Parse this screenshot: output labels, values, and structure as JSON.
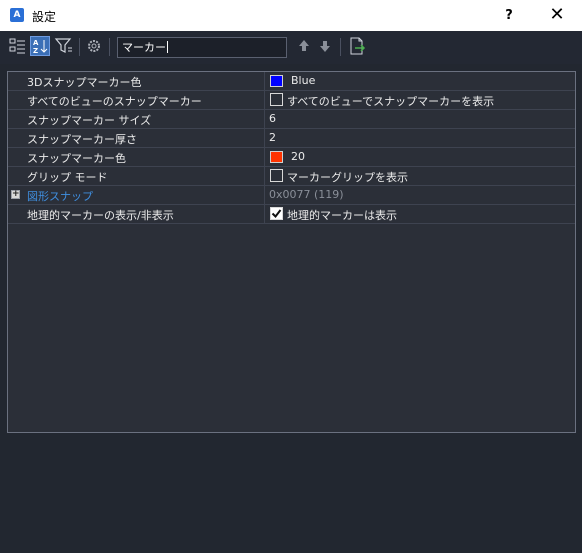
{
  "window": {
    "app_icon": "A",
    "title": "設定",
    "help_label": "?",
    "close_label": "✕"
  },
  "toolbar": {
    "search_value": "マーカー",
    "buttons": [
      {
        "name": "categorized-view-icon"
      },
      {
        "name": "alphabetical-sort-icon",
        "active": true
      },
      {
        "name": "filter-icon"
      },
      {
        "name": "settings-gear-icon"
      },
      {
        "name": "search-prev-icon"
      },
      {
        "name": "search-next-icon"
      },
      {
        "name": "export-icon"
      }
    ]
  },
  "properties": [
    {
      "name": "3Dスナップマーカー色",
      "value": "Blue",
      "swatch": "#0000ff"
    },
    {
      "name": "すべてのビューのスナップマーカー",
      "value": "すべてのビューでスナップマーカーを表示",
      "checkbox": false
    },
    {
      "name": "スナップマーカー サイズ",
      "value": "6"
    },
    {
      "name": "スナップマーカー厚さ",
      "value": "2"
    },
    {
      "name": "スナップマーカー色",
      "value": "20",
      "swatch": "#ff3300"
    },
    {
      "name": "グリップ モード",
      "value": "マーカーグリップを表示",
      "checkbox": false
    },
    {
      "name": "図形スナップ",
      "value": "0x0077 (119)",
      "expandable": true,
      "link": true,
      "dim": true
    },
    {
      "name": "地理的マーカーの表示/非表示",
      "value": "地理的マーカーは表示",
      "checkbox": true
    }
  ],
  "colors": {
    "background": "#222730",
    "grid_background": "#2b2f38",
    "link": "#3f8fe0",
    "accent_button": "#3b6fb6"
  }
}
